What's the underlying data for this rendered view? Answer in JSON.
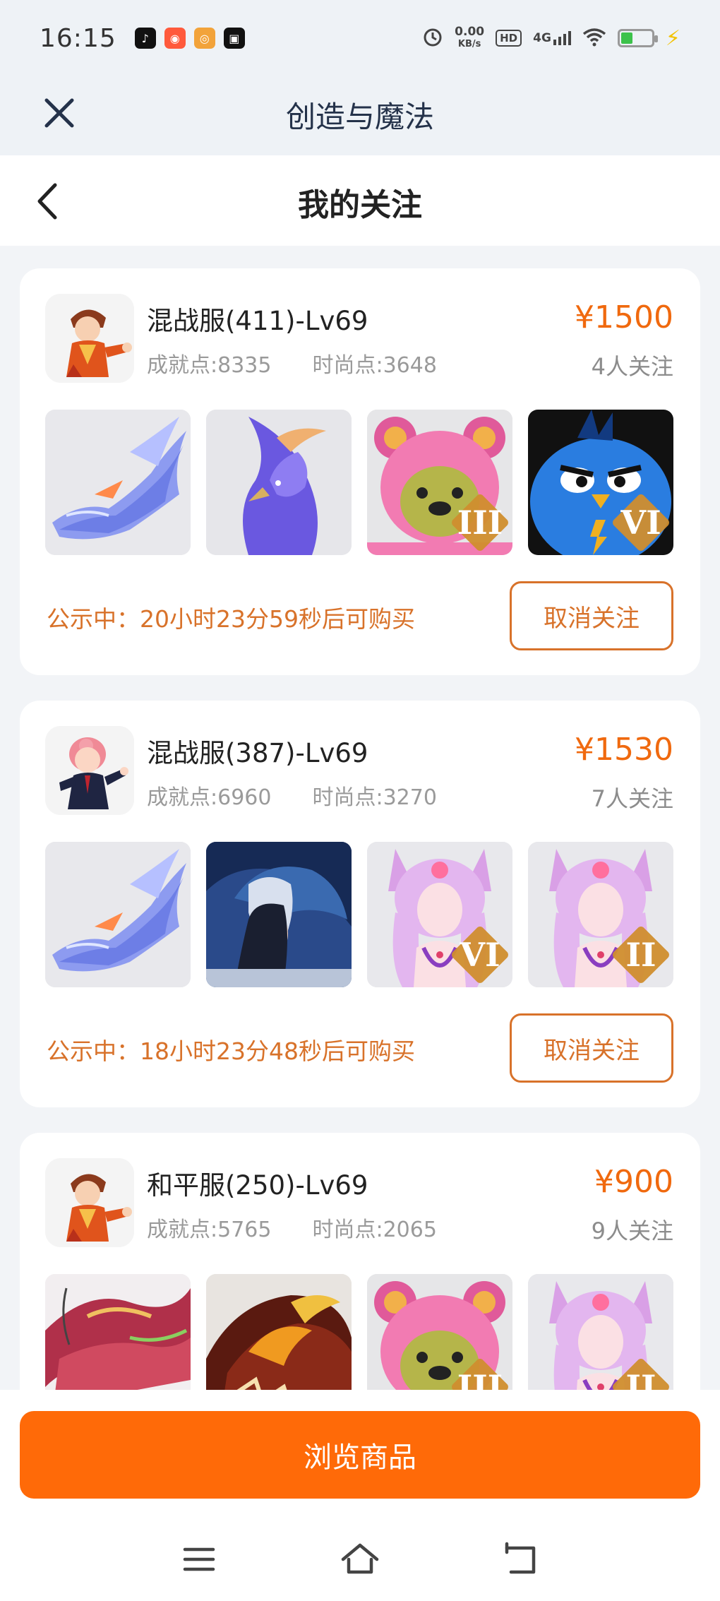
{
  "status_bar": {
    "time": "16:15",
    "net_speed_value": "0.00",
    "net_speed_unit": "KB/s",
    "hd_label": "HD",
    "network": "4G",
    "app_icons": [
      {
        "name": "tiktok-icon",
        "color": "#111111",
        "glyph": "♪"
      },
      {
        "name": "video-app-icon",
        "color": "#ff5a3c",
        "glyph": "◉"
      },
      {
        "name": "weibo-icon",
        "color": "#f2a33a",
        "glyph": "◎"
      },
      {
        "name": "camera-app-icon",
        "color": "#111111",
        "glyph": "▣"
      }
    ]
  },
  "header": {
    "app_title": "创造与魔法"
  },
  "page": {
    "title": "我的关注"
  },
  "cards": [
    {
      "server": "混战服(411)-Lv69",
      "achievement": "成就点:8335",
      "fashion": "时尚点:3648",
      "price": "¥1500",
      "followers": "4人关注",
      "notice": "公示中：20小时23分59秒后可购买",
      "cancel_label": "取消关注",
      "avatar": "boy",
      "thumbs": [
        {
          "kind": "ice-dragon",
          "rank": ""
        },
        {
          "kind": "blue-phoenix",
          "rank": ""
        },
        {
          "kind": "pink-bear",
          "rank": "III"
        },
        {
          "kind": "blue-bird",
          "rank": "VI"
        }
      ]
    },
    {
      "server": "混战服(387)-Lv69",
      "achievement": "成就点:6960",
      "fashion": "时尚点:3270",
      "price": "¥1530",
      "followers": "7人关注",
      "notice": "公示中：18小时23分48秒后可购买",
      "cancel_label": "取消关注",
      "avatar": "girl",
      "thumbs": [
        {
          "kind": "ice-dragon",
          "rank": ""
        },
        {
          "kind": "dark-dragon-rider",
          "rank": ""
        },
        {
          "kind": "fox-girl",
          "rank": "VI"
        },
        {
          "kind": "fox-girl",
          "rank": "II"
        }
      ]
    },
    {
      "server": "和平服(250)-Lv69",
      "achievement": "成就点:5765",
      "fashion": "时尚点:2065",
      "price": "¥900",
      "followers": "9人关注",
      "notice": "",
      "cancel_label": "",
      "avatar": "boy",
      "thumbs": [
        {
          "kind": "red-dragon",
          "rank": ""
        },
        {
          "kind": "fire-dragon",
          "rank": ""
        },
        {
          "kind": "pink-bear",
          "rank": "III"
        },
        {
          "kind": "fox-girl",
          "rank": "II"
        }
      ]
    }
  ],
  "footer": {
    "browse_label": "浏览商品"
  },
  "colors": {
    "accent": "#ff6a08",
    "price": "#f0690e",
    "notice": "#d8722a"
  }
}
